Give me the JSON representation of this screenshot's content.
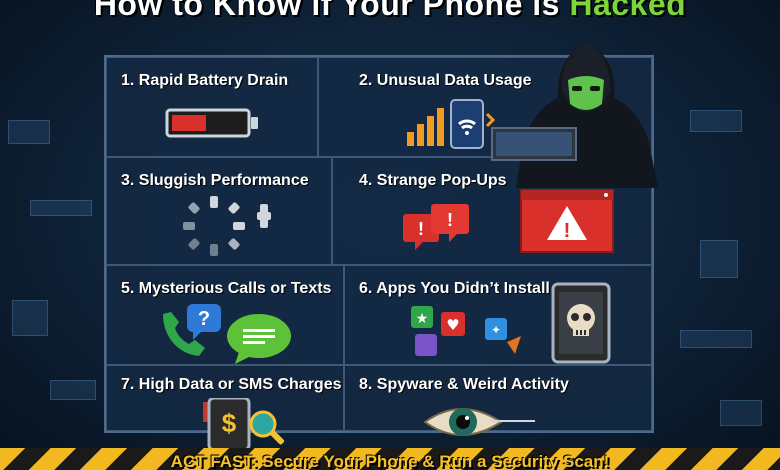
{
  "title": {
    "prefix": "How to Know if Your Phone is",
    "highlight": "Hacked"
  },
  "signs": [
    {
      "label": "1. Rapid Battery Drain"
    },
    {
      "label": "2. Unusual Data Usage"
    },
    {
      "label": "3. Sluggish Performance"
    },
    {
      "label": "4. Strange Pop-Ups"
    },
    {
      "label": "5. Mysterious Calls or Texts"
    },
    {
      "label": "6. Apps You Didn’t Install"
    },
    {
      "label": "7. High Data or SMS Charges"
    },
    {
      "label": "8. Spyware & Weird Activity"
    }
  ],
  "icons": {
    "battery": "battery-low-icon",
    "data": "data-usage-icon",
    "loading": "loading-spinner-icon",
    "popups": "warning-popup-icon",
    "calls": "phone-message-icon",
    "apps": "skull-phone-icon",
    "charges": "dollar-phone-icon",
    "spyware": "eye-icon"
  },
  "banner": {
    "text": "ACT FAST: Secure Your Phone & Run a Security Scan!"
  },
  "colors": {
    "accent_green": "#7cd63a",
    "warning_red": "#d9302b",
    "banner_yellow": "#f2b81f"
  }
}
